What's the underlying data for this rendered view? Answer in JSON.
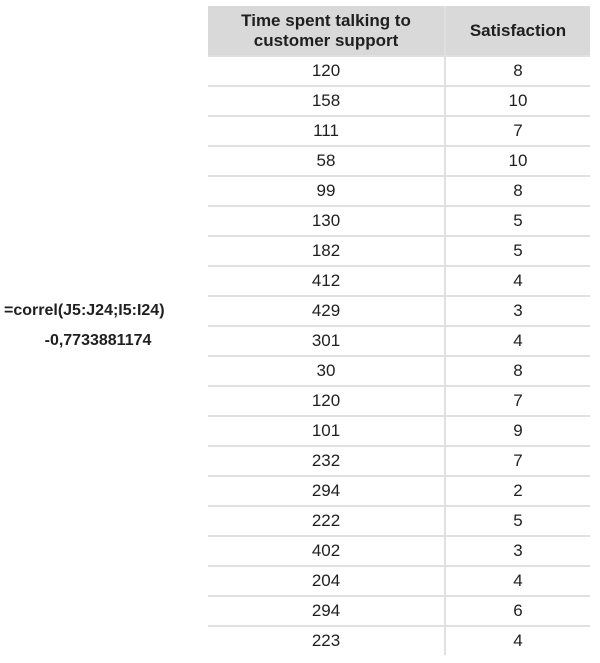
{
  "formula": "=correl(J5:J24;I5:I24)",
  "result": "-0,7733881174",
  "table": {
    "headers": [
      "Time spent talking to customer support",
      "Satisfaction"
    ],
    "rows": [
      [
        "120",
        "8"
      ],
      [
        "158",
        "10"
      ],
      [
        "111",
        "7"
      ],
      [
        "58",
        "10"
      ],
      [
        "99",
        "8"
      ],
      [
        "130",
        "5"
      ],
      [
        "182",
        "5"
      ],
      [
        "412",
        "4"
      ],
      [
        "429",
        "3"
      ],
      [
        "301",
        "4"
      ],
      [
        "30",
        "8"
      ],
      [
        "120",
        "7"
      ],
      [
        "101",
        "9"
      ],
      [
        "232",
        "7"
      ],
      [
        "294",
        "2"
      ],
      [
        "222",
        "5"
      ],
      [
        "402",
        "3"
      ],
      [
        "204",
        "4"
      ],
      [
        "294",
        "6"
      ],
      [
        "223",
        "4"
      ]
    ]
  }
}
